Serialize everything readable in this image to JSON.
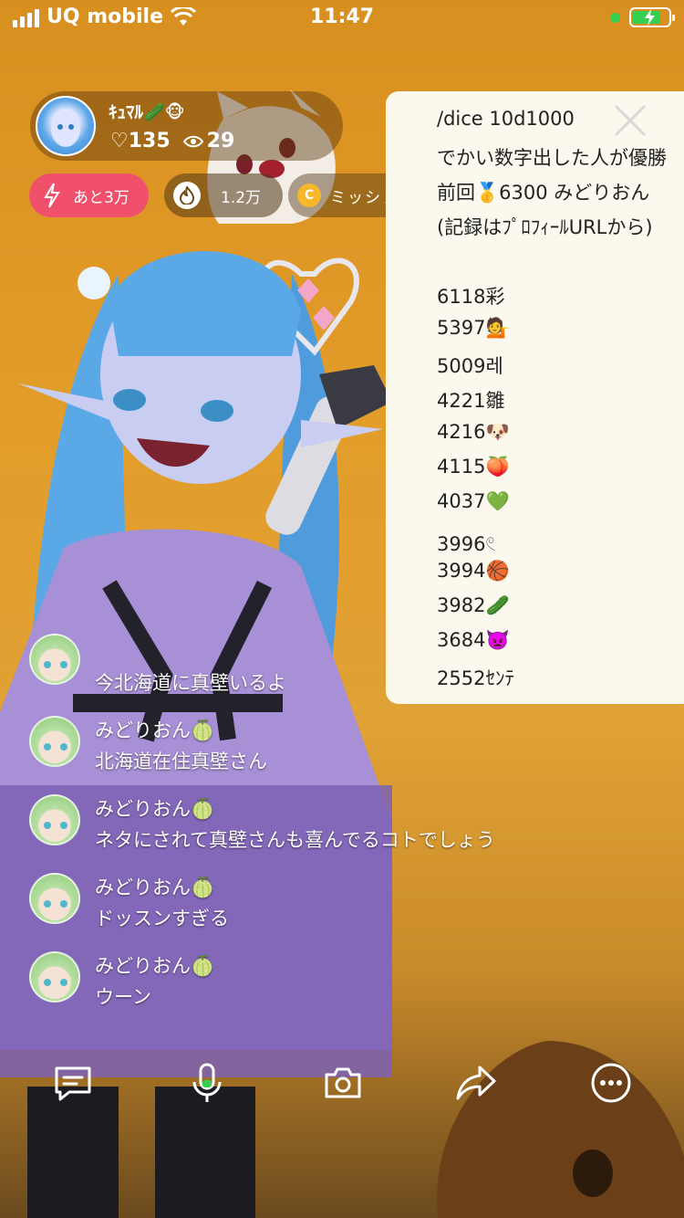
{
  "status_bar": {
    "carrier": "UQ mobile",
    "time": "11:47"
  },
  "host": {
    "name": "ｷｭﾏﾙ🥒🐵",
    "likes": "♡135",
    "viewers": "29"
  },
  "badges": {
    "boost": "あと3万",
    "points": "1.2万",
    "mission": "ミッション"
  },
  "dice_panel": {
    "lines": [
      "/dice 10d1000",
      "でかい数字出した人が優勝",
      "前回🥇6300 みどりおん",
      "(記録はﾌﾟﾛﾌｨｰﾙURLから)"
    ],
    "scores": [
      "6118彩",
      "5397💁",
      "5009레",
      "4221雛",
      "4216🐶",
      "4115🍑",
      "4037💚",
      "3996𓏲",
      "3994🏀",
      "3982🥒",
      "3684👿",
      "2552ｾﾝﾃ"
    ]
  },
  "chat": {
    "messages": [
      {
        "name": "",
        "text": "今北海道に真壁いるよ"
      },
      {
        "name": "みどりおん🍈",
        "text": "北海道在住真壁さん"
      },
      {
        "name": "みどりおん🍈",
        "text": "ネタにされて真壁さんも喜んでるコトでしょう"
      },
      {
        "name": "みどりおん🍈",
        "text": "ドッスンすぎる"
      },
      {
        "name": "みどりおん🍈",
        "text": "ウーン"
      }
    ]
  },
  "toolbar": {
    "icons": [
      "comment-icon",
      "microphone-icon",
      "camera-icon",
      "share-icon",
      "more-icon"
    ]
  },
  "colors": {
    "background": "#e39d2a",
    "accent_red": "#f0506a",
    "panel_bg": "#fbf8ee",
    "battery_green": "#35d04f",
    "coin": "#f6b82a"
  }
}
